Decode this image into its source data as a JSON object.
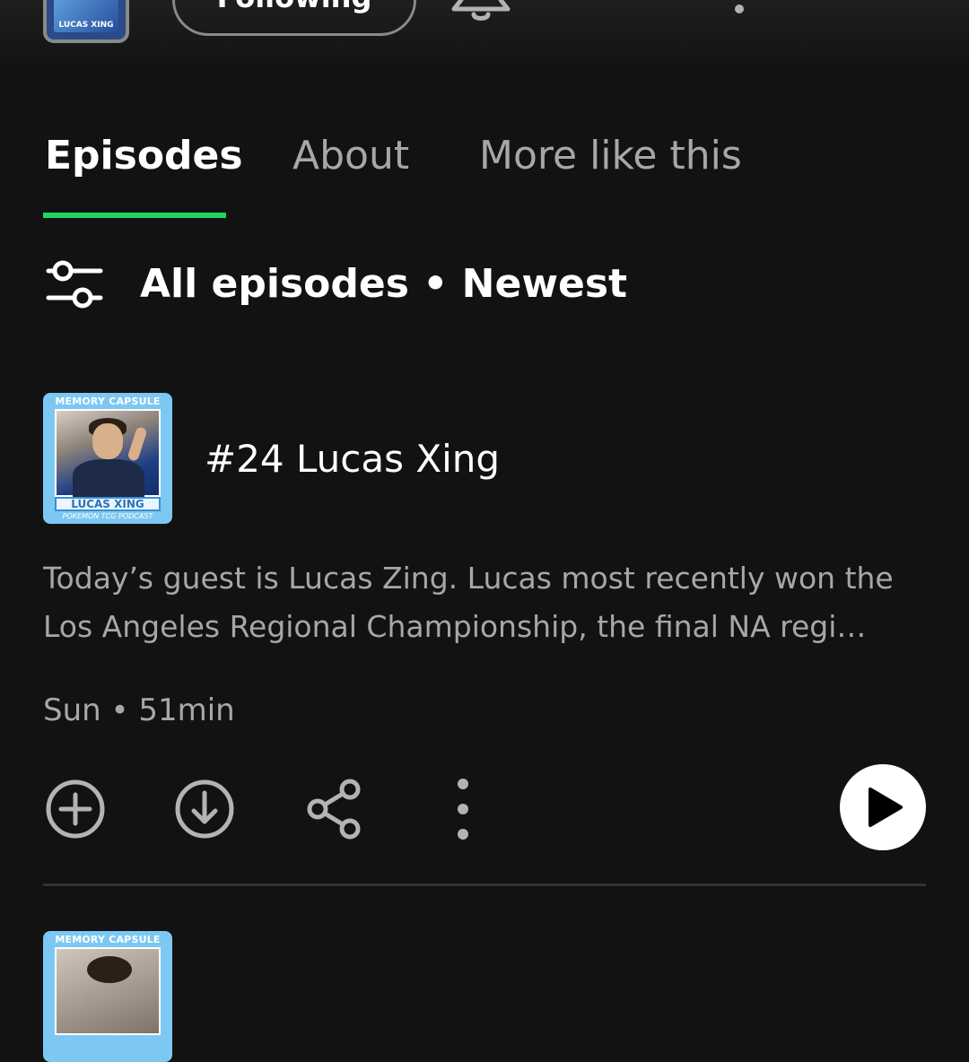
{
  "header": {
    "thumb_caption": "LUCAS XING",
    "following_label": "Following",
    "icons": [
      "bell-icon",
      "gear-icon",
      "more-vertical-icon"
    ]
  },
  "tabs": [
    {
      "label": "Episodes",
      "active": true
    },
    {
      "label": "About",
      "active": false
    },
    {
      "label": "More like this",
      "active": false
    }
  ],
  "filter": {
    "icon": "filter-sliders-icon",
    "label": "All episodes • Newest"
  },
  "episode": {
    "cover": {
      "top_text": "MEMORY CAPSULE",
      "name_text": "LUCAS XING",
      "bottom_text": "POKEMON TCG PODCAST"
    },
    "title": "#24 Lucas Xing",
    "description_lines": [
      "Today’s guest is Lucas Zing. Lucas most recently won the",
      "Los Angeles Regional Championship, the final NA regi…"
    ],
    "meta": "Sun • 51min",
    "actions": [
      "add-circle-icon",
      "download-circle-icon",
      "share-icon",
      "more-vertical-icon"
    ],
    "play_icon": "play-icon"
  },
  "next_episode": {
    "cover": {
      "top_text": "MEMORY CAPSULE"
    }
  },
  "colors": {
    "background": "#121212",
    "accent": "#1ed760",
    "text_primary": "#ffffff",
    "text_secondary": "#a7a7a7",
    "icon": "#b3b3b3"
  }
}
